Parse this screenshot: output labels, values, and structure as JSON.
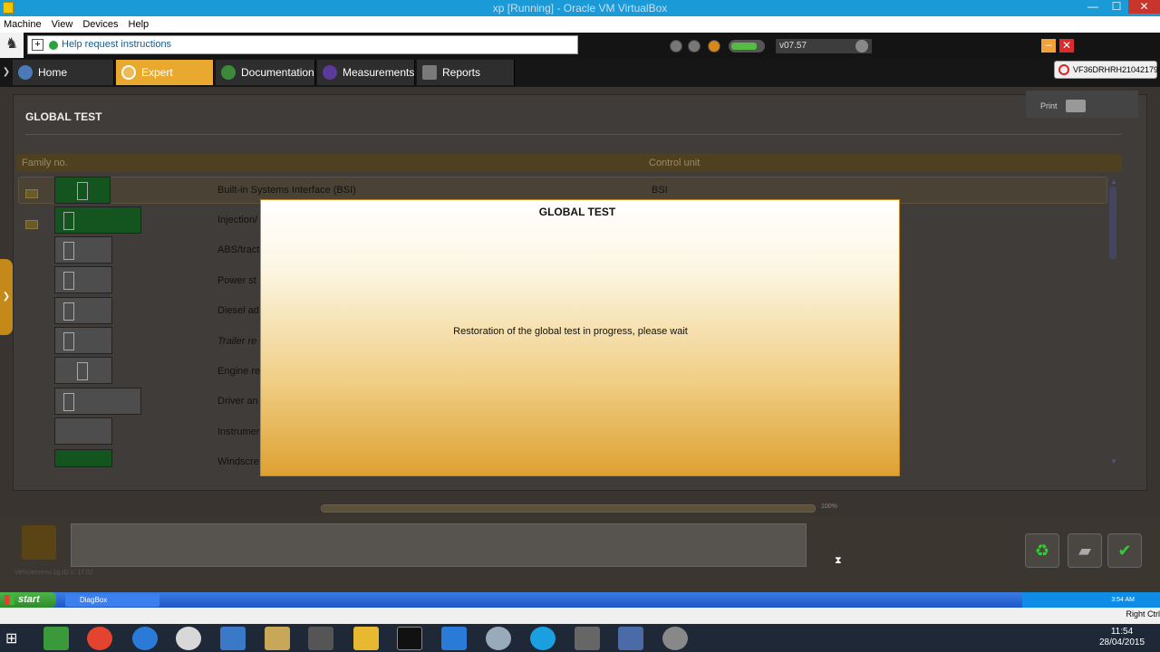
{
  "vbox": {
    "title": "xp [Running] - Oracle VM VirtualBox",
    "menu": [
      "Machine",
      "View",
      "Devices",
      "Help"
    ],
    "right_ctrl": "Right Ctrl"
  },
  "app": {
    "help_text": "Help request instructions",
    "version": "v07.57",
    "vin": "VF36DRHRH21042179",
    "tabs": [
      {
        "label": "Home"
      },
      {
        "label": "Expert",
        "active": true
      },
      {
        "label": "Documentation"
      },
      {
        "label": "Measurements"
      },
      {
        "label": "Reports"
      }
    ],
    "page_title": "GLOBAL TEST",
    "print_label": "Print",
    "table": {
      "col_family": "Family no.",
      "col_control": "Control unit",
      "rows": [
        {
          "name": "Built-in Systems Interface (BSI)",
          "unit": "BSI"
        },
        {
          "name": "Injection/"
        },
        {
          "name": "ABS/tract"
        },
        {
          "name": "Power st"
        },
        {
          "name": "Diesel ad"
        },
        {
          "name": "Trailer re"
        },
        {
          "name": "Engine re"
        },
        {
          "name": "Driver an"
        },
        {
          "name": "Instrumer"
        },
        {
          "name": "Windscre"
        }
      ]
    },
    "progress_pct": "100%",
    "status_small": "Vehiclemenu-1g d2 c: 17.02",
    "modal": {
      "title": "GLOBAL TEST",
      "message": "Restoration of the global test in progress, please wait"
    }
  },
  "xp": {
    "start": "start",
    "task": "DiagBox",
    "clock": "3:54 AM"
  },
  "win8": {
    "time": "11:54",
    "date": "28/04/2015"
  },
  "colors": {
    "accent": "#e8a92e",
    "vbox_title": "#1a9ad6",
    "xp_taskbar": "#2a66d4"
  }
}
